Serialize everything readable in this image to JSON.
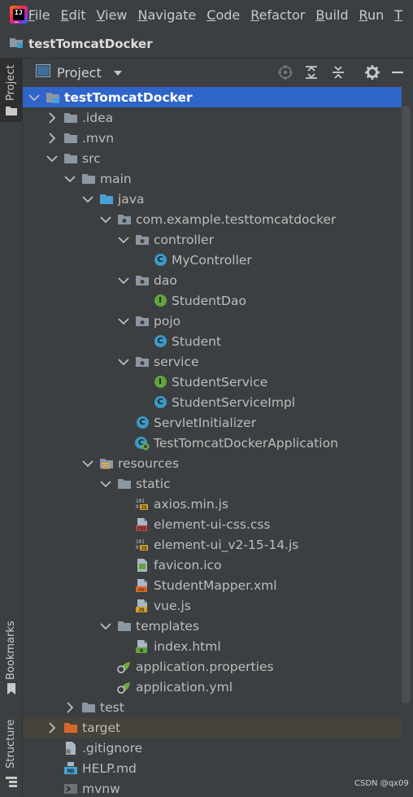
{
  "menu": {
    "items": [
      {
        "mnemonic": "F",
        "rest": "ile"
      },
      {
        "mnemonic": "E",
        "rest": "dit"
      },
      {
        "mnemonic": "V",
        "rest": "iew"
      },
      {
        "mnemonic": "N",
        "rest": "avigate"
      },
      {
        "mnemonic": "C",
        "rest": "ode"
      },
      {
        "mnemonic": "R",
        "rest": "efactor"
      },
      {
        "mnemonic": "B",
        "rest": "uild"
      },
      {
        "mnemonic": "R",
        "rest": "un"
      },
      {
        "mnemonic": "T",
        "rest": ""
      }
    ]
  },
  "titlebar": {
    "project_name": "testTomcatDocker"
  },
  "stripe": {
    "project_tab": "Project",
    "bookmarks_tab": "Bookmarks",
    "structure_tab": "Structure"
  },
  "pane": {
    "view_label": "Project"
  },
  "tree": [
    {
      "label": "testTomcatDocker",
      "icon": "module-folder-icon",
      "state": "expanded",
      "level": 0,
      "selected": true
    },
    {
      "label": ".idea",
      "icon": "folder-icon",
      "state": "collapsed",
      "level": 1
    },
    {
      "label": ".mvn",
      "icon": "folder-icon",
      "state": "collapsed",
      "level": 1
    },
    {
      "label": "src",
      "icon": "folder-icon",
      "state": "expanded",
      "level": 1
    },
    {
      "label": "main",
      "icon": "folder-icon",
      "state": "expanded",
      "level": 2
    },
    {
      "label": "java",
      "icon": "source-root-icon",
      "state": "expanded",
      "level": 3
    },
    {
      "label": "com.example.testtomcatdocker",
      "icon": "package-icon",
      "state": "expanded",
      "level": 4
    },
    {
      "label": "controller",
      "icon": "package-icon",
      "state": "expanded",
      "level": 5
    },
    {
      "label": "MyController",
      "icon": "class-icon",
      "state": "leaf",
      "level": 6
    },
    {
      "label": "dao",
      "icon": "package-icon",
      "state": "expanded",
      "level": 5
    },
    {
      "label": "StudentDao",
      "icon": "interface-icon",
      "state": "leaf",
      "level": 6
    },
    {
      "label": "pojo",
      "icon": "package-icon",
      "state": "expanded",
      "level": 5
    },
    {
      "label": "Student",
      "icon": "class-icon",
      "state": "leaf",
      "level": 6
    },
    {
      "label": "service",
      "icon": "package-icon",
      "state": "expanded",
      "level": 5
    },
    {
      "label": "StudentService",
      "icon": "interface-icon",
      "state": "leaf",
      "level": 6
    },
    {
      "label": "StudentServiceImpl",
      "icon": "class-icon",
      "state": "leaf",
      "level": 6
    },
    {
      "label": "ServletInitializer",
      "icon": "class-icon",
      "state": "leaf",
      "level": 5
    },
    {
      "label": "TestTomcatDockerApplication",
      "icon": "spring-boot-class-icon",
      "state": "leaf",
      "level": 5
    },
    {
      "label": "resources",
      "icon": "resources-root-icon",
      "state": "expanded",
      "level": 3
    },
    {
      "label": "static",
      "icon": "folder-icon",
      "state": "expanded",
      "level": 4
    },
    {
      "label": "axios.min.js",
      "icon": "minified-js-file-icon",
      "state": "leaf",
      "level": 5
    },
    {
      "label": "element-ui-css.css",
      "icon": "css-file-icon",
      "state": "leaf",
      "level": 5
    },
    {
      "label": "element-ui_v2-15-14.js",
      "icon": "minified-js-file-icon",
      "state": "leaf",
      "level": 5
    },
    {
      "label": "favicon.ico",
      "icon": "image-file-icon",
      "state": "leaf",
      "level": 5
    },
    {
      "label": "StudentMapper.xml",
      "icon": "xml-file-icon",
      "state": "leaf",
      "level": 5
    },
    {
      "label": "vue.js",
      "icon": "js-file-icon",
      "state": "leaf",
      "level": 5
    },
    {
      "label": "templates",
      "icon": "folder-icon",
      "state": "expanded",
      "level": 4
    },
    {
      "label": "index.html",
      "icon": "html-file-icon",
      "state": "leaf",
      "level": 5
    },
    {
      "label": "application.properties",
      "icon": "spring-config-file-icon",
      "state": "leaf",
      "level": 4
    },
    {
      "label": "application.yml",
      "icon": "spring-config-file-icon",
      "state": "leaf",
      "level": 4
    },
    {
      "label": "test",
      "icon": "folder-icon",
      "state": "collapsed",
      "level": 2
    },
    {
      "label": "target",
      "icon": "excluded-folder-icon",
      "state": "collapsed",
      "level": 1,
      "excluded": true
    },
    {
      "label": ".gitignore",
      "icon": "gitignore-file-icon",
      "state": "leaf",
      "level": 1
    },
    {
      "label": "HELP.md",
      "icon": "markdown-file-icon",
      "state": "leaf",
      "level": 1
    },
    {
      "label": "mvnw",
      "icon": "shell-file-icon",
      "state": "leaf",
      "level": 1
    }
  ],
  "watermark": "CSDN @qx09",
  "colors": {
    "panel": "#3c3f41",
    "selection": "#2f65ca",
    "folder": "#8b97a3",
    "source_root": "#4a9fd6",
    "excluded_folder": "#d8672a",
    "class_badge": "#3d99c7",
    "interface_badge": "#62a33f",
    "spring_green": "#6da944"
  }
}
